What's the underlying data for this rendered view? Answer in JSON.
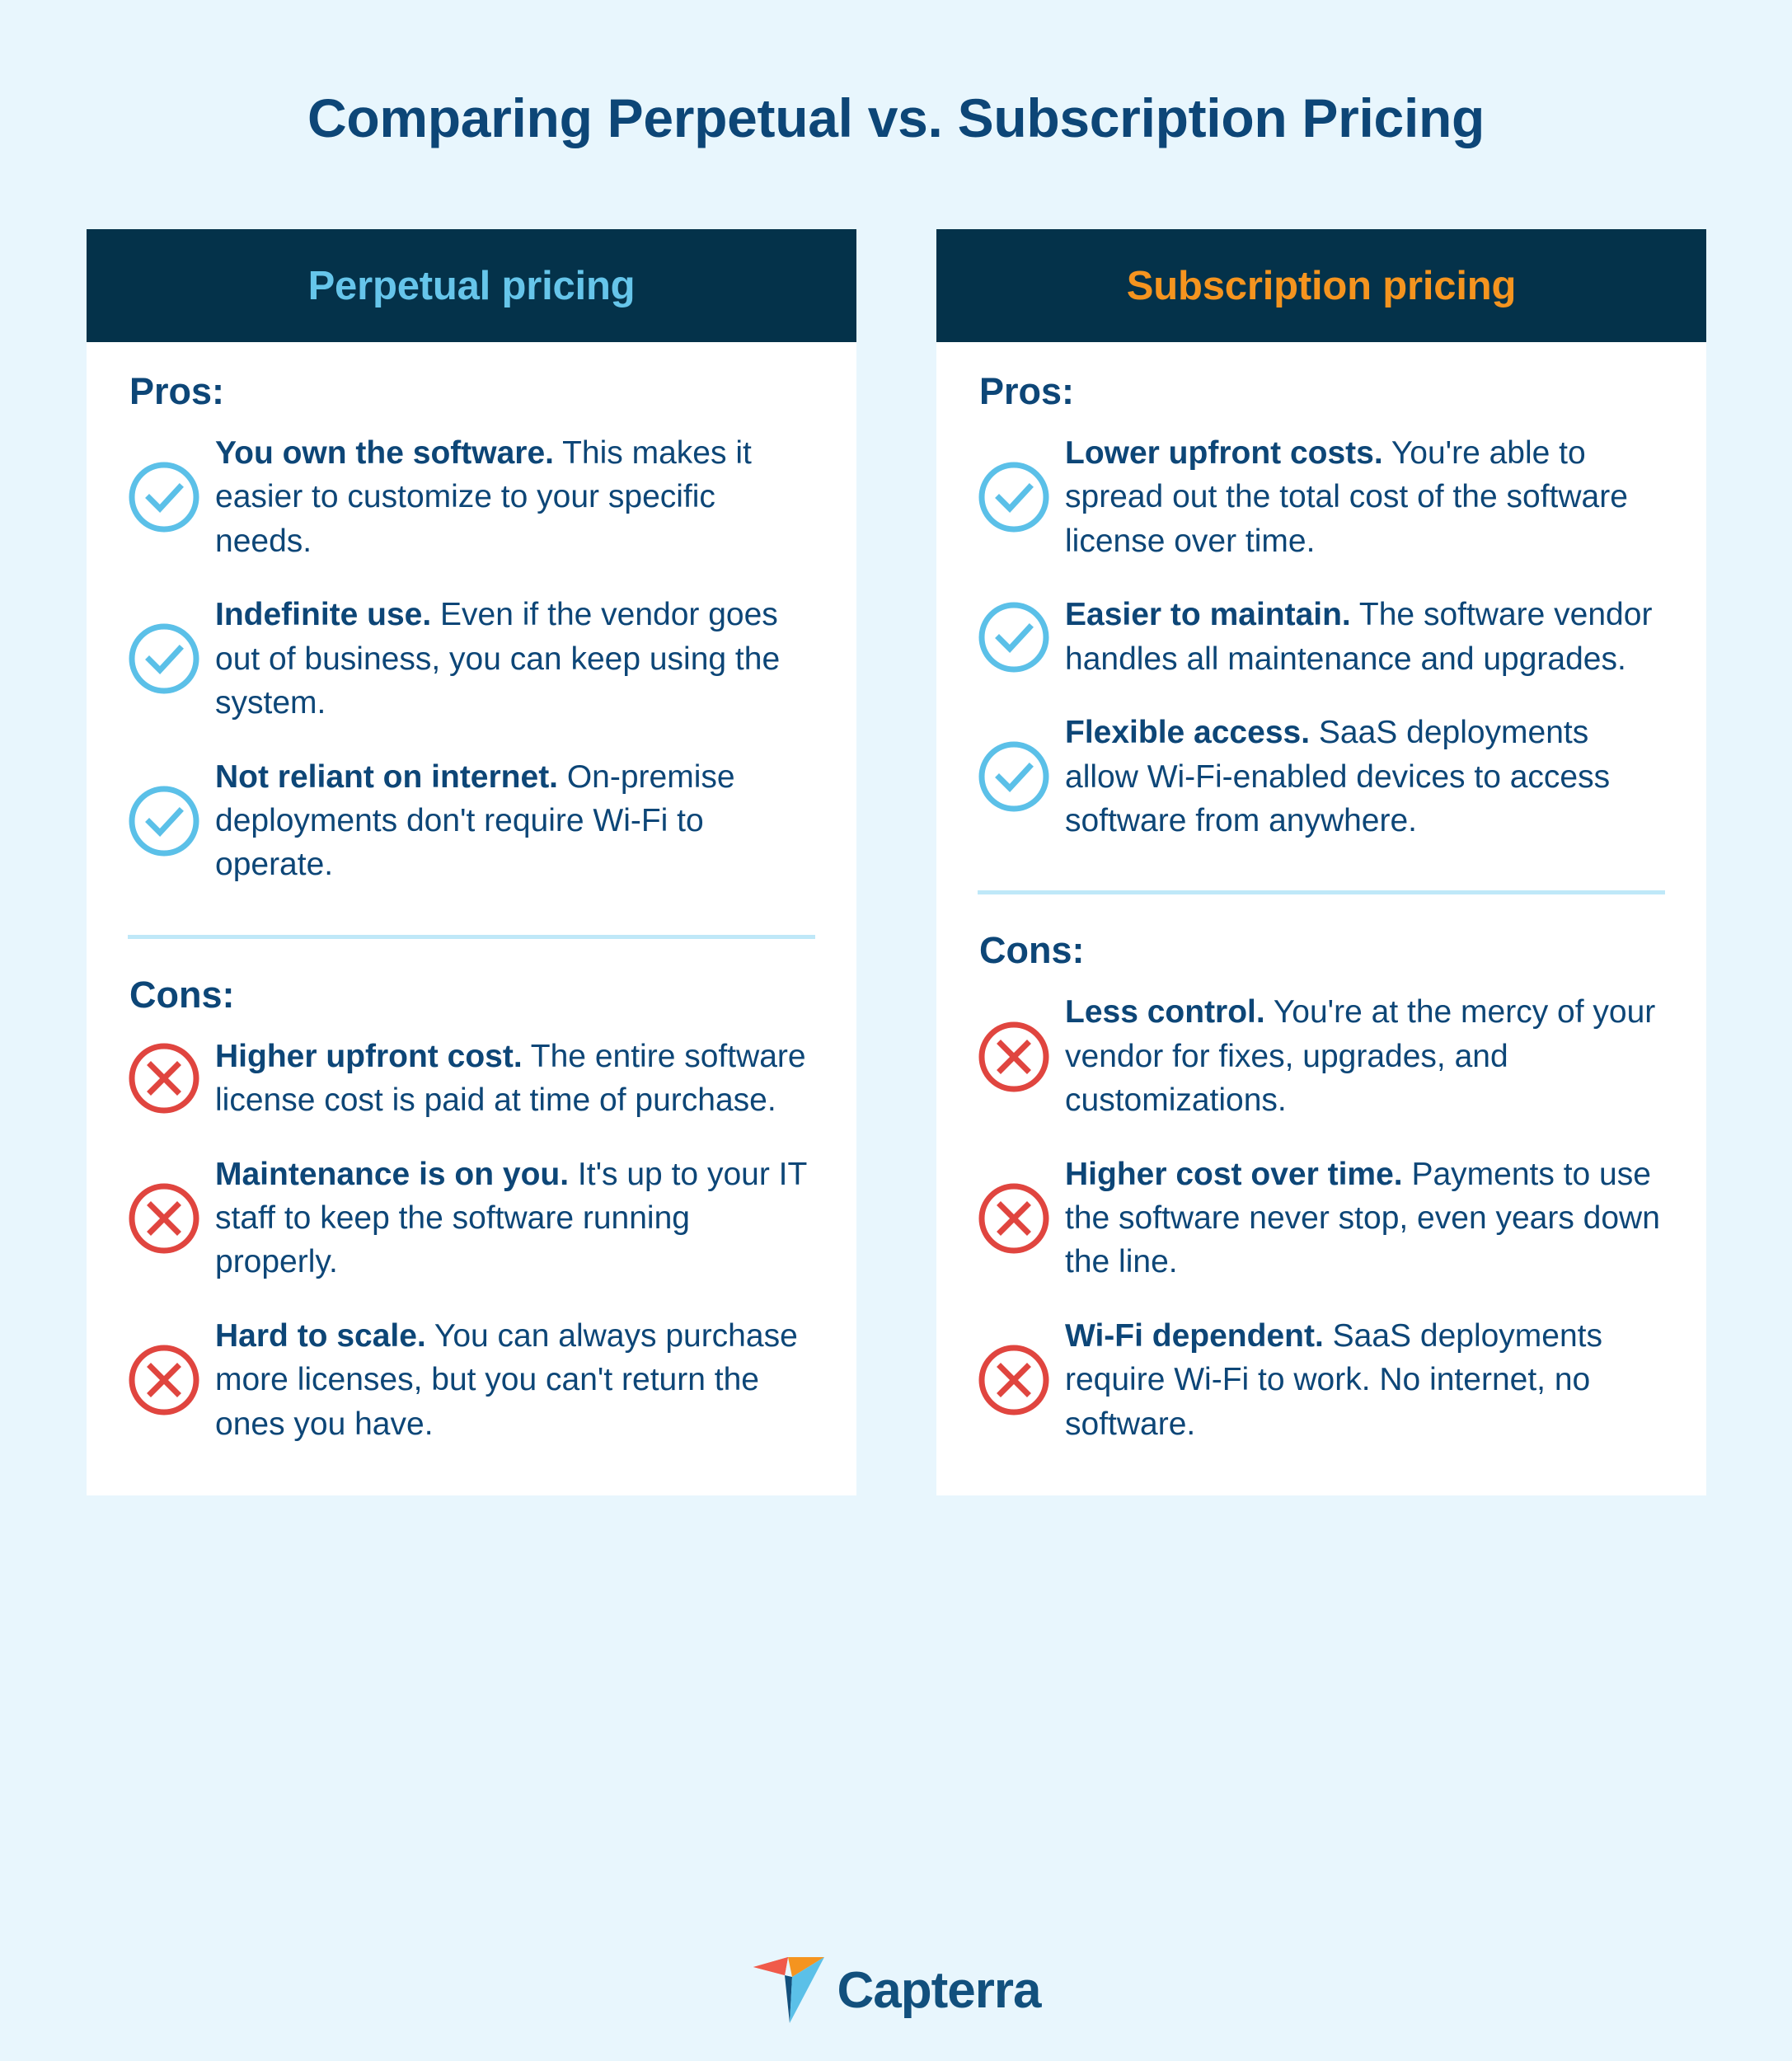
{
  "page": {
    "title": "Comparing Perpetual vs. Subscription Pricing",
    "background_color": "#e8f6fd"
  },
  "colors": {
    "title_navy": "#0d4677",
    "header_bar": "#04324a",
    "perpetual_accent": "#66c5ea",
    "subscription_accent": "#f5941f",
    "check_icon": "#5bc0e8",
    "x_icon": "#e0453f",
    "divider": "#bfe8f8",
    "card_background": "#ffffff"
  },
  "columns": [
    {
      "header": "Perpetual pricing",
      "header_color": "#66c5ea",
      "pros_label": "Pros:",
      "cons_label": "Cons:",
      "pros": [
        {
          "icon": "check-circle-icon",
          "bold": "You own the software.",
          "text": " This makes it easier to customize to your specific needs."
        },
        {
          "icon": "check-circle-icon",
          "bold": "Indefinite use.",
          "text": " Even if the vendor goes out of business, you can keep using the system."
        },
        {
          "icon": "check-circle-icon",
          "bold": "Not reliant on internet.",
          "text": " On-premise deployments don't require Wi-Fi to operate."
        }
      ],
      "cons": [
        {
          "icon": "x-circle-icon",
          "bold": "Higher upfront cost.",
          "text": " The entire software license cost is paid at time of purchase."
        },
        {
          "icon": "x-circle-icon",
          "bold": "Maintenance is on you.",
          "text": " It's up to your IT staff to keep the software running properly."
        },
        {
          "icon": "x-circle-icon",
          "bold": "Hard to scale.",
          "text": " You can always purchase more licenses, but you can't return the ones you have."
        }
      ]
    },
    {
      "header": "Subscription pricing",
      "header_color": "#f5941f",
      "pros_label": "Pros:",
      "cons_label": "Cons:",
      "pros": [
        {
          "icon": "check-circle-icon",
          "bold": "Lower upfront costs.",
          "text": " You're able to spread out the total cost of the software license over time."
        },
        {
          "icon": "check-circle-icon",
          "bold": "Easier to maintain.",
          "text": " The software vendor handles all maintenance and upgrades."
        },
        {
          "icon": "check-circle-icon",
          "bold": "Flexible access.",
          "text": " SaaS deployments allow Wi-Fi-enabled devices to access software from anywhere."
        }
      ],
      "cons": [
        {
          "icon": "x-circle-icon",
          "bold": "Less control.",
          "text": " You're at the mercy of your vendor for fixes, upgrades, and customizations."
        },
        {
          "icon": "x-circle-icon",
          "bold": "Higher cost over time.",
          "text": " Payments to use the software never stop, even years down the line."
        },
        {
          "icon": "x-circle-icon",
          "bold": "Wi-Fi dependent.",
          "text": " SaaS deployments require Wi-Fi to work. No internet, no software."
        }
      ]
    }
  ],
  "footer": {
    "brand": "Capterra",
    "logo_icon": "capterra-paper-plane-logo"
  }
}
